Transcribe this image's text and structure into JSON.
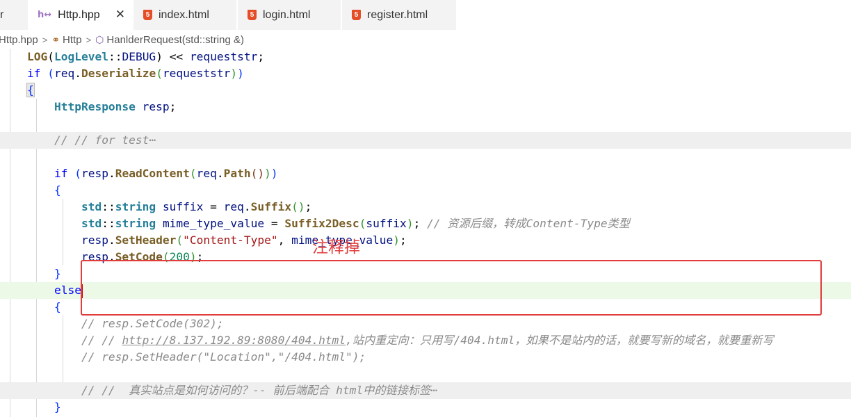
{
  "tabs": [
    {
      "label": "r"
    },
    {
      "label": "Http.hpp",
      "icon": "h-icon",
      "active": true,
      "close": "✕"
    },
    {
      "label": "index.html",
      "icon": "html5-icon"
    },
    {
      "label": "login.html",
      "icon": "html5-icon"
    },
    {
      "label": "register.html",
      "icon": "html5-icon"
    }
  ],
  "breadcrumb": {
    "file": "Http.hpp",
    "class": "Http",
    "method": "HanlderRequest(std::string &)"
  },
  "code": {
    "l1": {
      "macro": "LOG",
      "type": "LogLevel",
      "member": "DEBUG",
      "op": "<<",
      "arg": "requeststr",
      "tail": ";"
    },
    "l2": {
      "kw": "if",
      "obj": "req",
      "fn": "Deserialize",
      "arg": "requeststr"
    },
    "l3": {
      "brace": "{"
    },
    "l4": {
      "cls": "HttpResponse",
      "var": "resp",
      "tail": ";"
    },
    "l6": {
      "comment": "// // for test"
    },
    "l6_fold": "⋯",
    "l8": {
      "kw": "if",
      "obj": "resp",
      "fn": "ReadContent",
      "obj2": "req",
      "fn2": "Path"
    },
    "l9": {
      "brace": "{"
    },
    "l10": {
      "ns": "std",
      "type": "string",
      "var": "suffix",
      "obj": "req",
      "fn": "Suffix"
    },
    "l11": {
      "ns": "std",
      "type": "string",
      "var": "mime_type_value",
      "fn": "Suffix2Desc",
      "arg": "suffix",
      "comment": "// 资源后缀，转成Content-Type类型"
    },
    "l12": {
      "obj": "resp",
      "fn": "SetHeader",
      "str": "\"Content-Type\"",
      "arg": "mime_type_value"
    },
    "l13": {
      "obj": "resp",
      "fn": "SetCode",
      "num": "200"
    },
    "l14": {
      "brace": "}"
    },
    "l15": {
      "kw": "else"
    },
    "l16": {
      "brace": "{"
    },
    "l17": {
      "comment": "// resp.SetCode(302);"
    },
    "l18": {
      "prefix": "// // ",
      "link": "http://8.137.192.89:8080/404.html",
      "rest": ",站内重定向：只用写/404.html，如果不是站内的话，就要写新的域名，就要重新写"
    },
    "l19": {
      "comment": "// resp.SetHeader(\"Location\",\"/404.html\");"
    },
    "l21": {
      "comment": "// //  真实站点是如何访问的？-- 前后端配合 html中的链接标签"
    },
    "l21_fold": "⋯",
    "l22": {
      "brace": "}"
    }
  },
  "annotation": "注释掉"
}
